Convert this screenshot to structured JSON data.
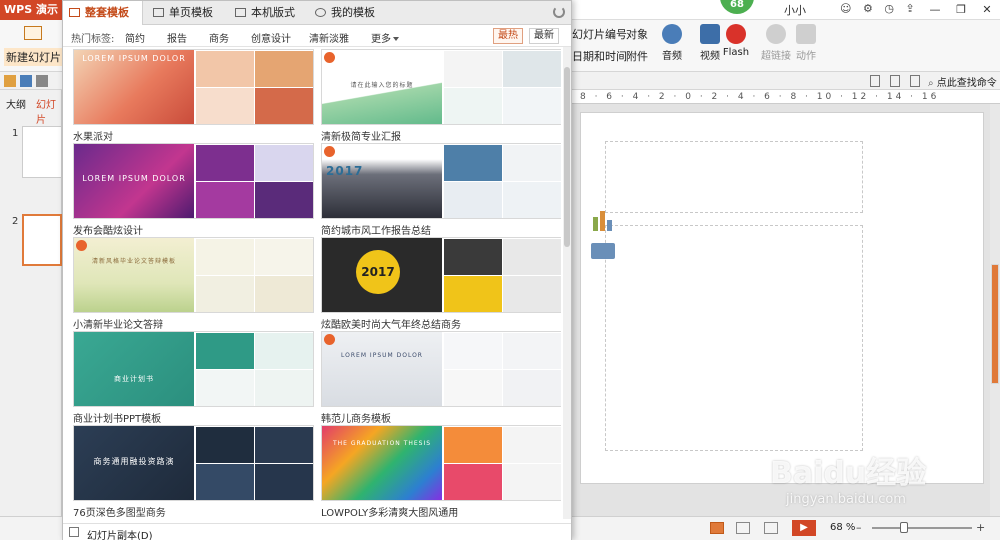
{
  "app": {
    "title_fragment": "WPS 演示",
    "user_name": "小小",
    "badge_count": "68",
    "accent_color": "#d24726"
  },
  "ribbon": {
    "new_slide_label": "新建幻灯片",
    "items": [
      "幻灯片编号",
      "对象",
      "日期和时间",
      "附件"
    ],
    "big_buttons": [
      "音频",
      "视频",
      "Flash",
      "超链接",
      "动作"
    ]
  },
  "toolbar2": {
    "find_label": "点此查找命令"
  },
  "left_panel": {
    "tab_outline": "大纲",
    "tab_slides": "幻灯片",
    "slides": [
      "1",
      "2"
    ]
  },
  "ruler": {
    "text": "8 · 6 · 4 · 2 · 0 · 2 · 4 · 6 · 8 · 10 · 12 · 14 · 16"
  },
  "dialog": {
    "tabs": [
      {
        "label": "整套模板",
        "icon": "template-set-icon"
      },
      {
        "label": "单页模板",
        "icon": "single-page-icon"
      },
      {
        "label": "本机版式",
        "icon": "local-layout-icon"
      },
      {
        "label": "我的模板",
        "icon": "user-icon"
      }
    ],
    "hot_tags_label": "热门标签:",
    "tags": [
      "简约",
      "报告",
      "商务",
      "创意设计",
      "清新淡雅"
    ],
    "more_label": "更多",
    "sort_hot": "最热",
    "sort_new": "最新",
    "templates": [
      {
        "name": "水果派对",
        "caption": "LOREM IPSUM DOLOR"
      },
      {
        "name": "清新极简专业汇报",
        "caption": "请在此输入您的标题"
      },
      {
        "name": "发布会酷炫设计",
        "caption": "LOREM IPSUM DOLOR"
      },
      {
        "name": "简约城市风工作报告总结",
        "caption": "2017"
      },
      {
        "name": "小清新毕业论文答辩",
        "caption": "清新风格毕业论文答辩模板"
      },
      {
        "name": "炫酷欧美时尚大气年终总结商务",
        "caption": "2017"
      },
      {
        "name": "商业计划书PPT模板",
        "caption": "商业计划书"
      },
      {
        "name": "韩范儿商务模板",
        "caption": "LOREM IPSUM DOLOR"
      },
      {
        "name": "76页深色多图型商务",
        "caption": "商务通用融投资路演"
      },
      {
        "name": "LOWPOLY多彩清爽大图风通用",
        "caption": "THE GRADUATION THESIS"
      }
    ],
    "footer_label": "幻灯片副本(D)"
  },
  "statusbar": {
    "zoom": "68 %"
  },
  "watermark": {
    "brand": "Baidu经验",
    "url": "jingyan.baidu.com"
  }
}
